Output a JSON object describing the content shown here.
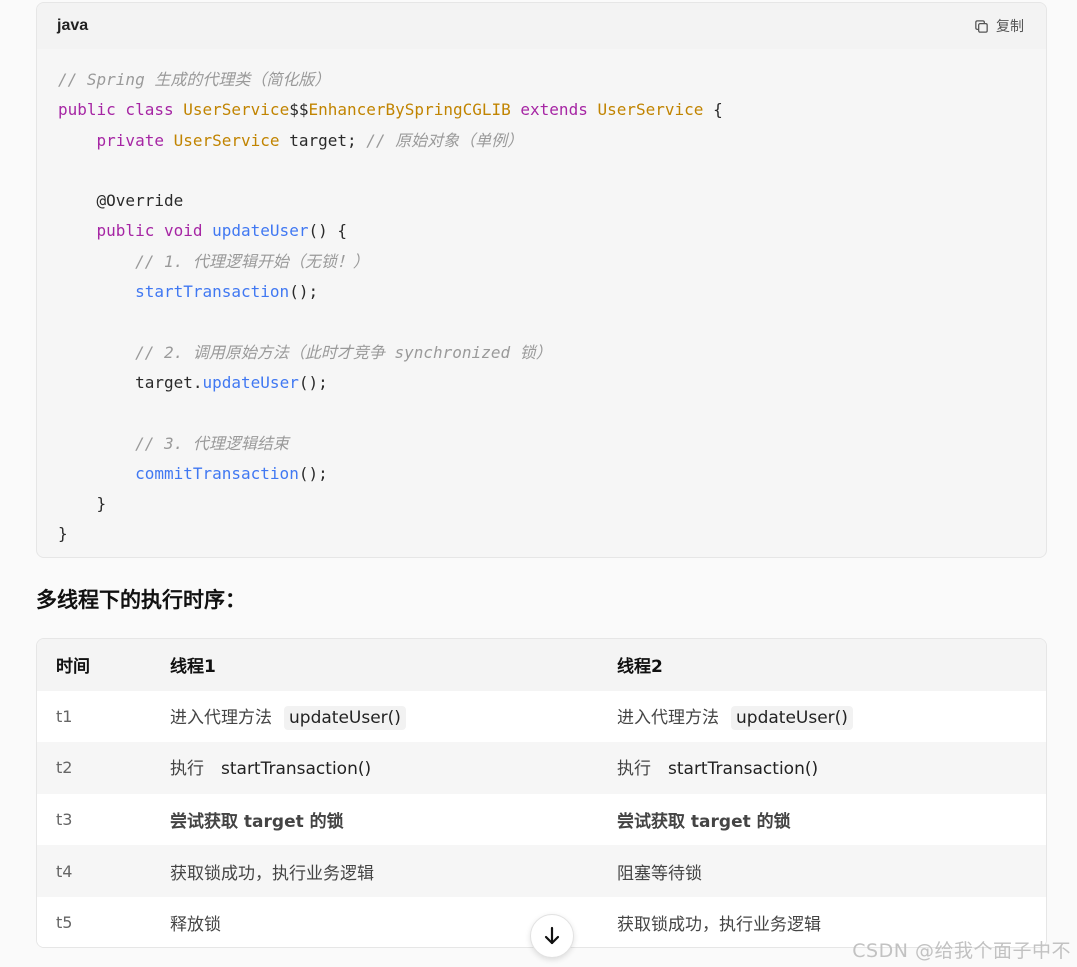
{
  "code_block": {
    "language": "java",
    "copy_label": "复制",
    "lines": [
      [
        {
          "t": "// Spring 生成的代理类（简化版）",
          "c": "comment"
        }
      ],
      [
        {
          "t": "public class ",
          "c": "kw"
        },
        {
          "t": "UserService",
          "c": "type"
        },
        {
          "t": "$$",
          "c": "plain"
        },
        {
          "t": "EnhancerBySpringCGLIB",
          "c": "type"
        },
        {
          "t": " extends ",
          "c": "kw"
        },
        {
          "t": "UserService",
          "c": "type"
        },
        {
          "t": " {",
          "c": "plain"
        }
      ],
      [
        {
          "t": "    ",
          "c": "plain"
        },
        {
          "t": "private ",
          "c": "kw"
        },
        {
          "t": "UserService",
          "c": "type"
        },
        {
          "t": " target; ",
          "c": "plain"
        },
        {
          "t": "// 原始对象（单例）",
          "c": "comment"
        }
      ],
      [],
      [
        {
          "t": "    @Override",
          "c": "plain"
        }
      ],
      [
        {
          "t": "    ",
          "c": "plain"
        },
        {
          "t": "public void ",
          "c": "kw"
        },
        {
          "t": "updateUser",
          "c": "fn"
        },
        {
          "t": "() {",
          "c": "plain"
        }
      ],
      [
        {
          "t": "        ",
          "c": "plain"
        },
        {
          "t": "// 1. 代理逻辑开始（无锁！）",
          "c": "comment"
        }
      ],
      [
        {
          "t": "        ",
          "c": "plain"
        },
        {
          "t": "startTransaction",
          "c": "fn"
        },
        {
          "t": "();",
          "c": "plain"
        }
      ],
      [],
      [
        {
          "t": "        ",
          "c": "plain"
        },
        {
          "t": "// 2. 调用原始方法（此时才竞争 synchronized 锁）",
          "c": "comment"
        }
      ],
      [
        {
          "t": "        target.",
          "c": "plain"
        },
        {
          "t": "updateUser",
          "c": "fn"
        },
        {
          "t": "();",
          "c": "plain"
        }
      ],
      [],
      [
        {
          "t": "        ",
          "c": "plain"
        },
        {
          "t": "// 3. 代理逻辑结束",
          "c": "comment"
        }
      ],
      [
        {
          "t": "        ",
          "c": "plain"
        },
        {
          "t": "commitTransaction",
          "c": "fn"
        },
        {
          "t": "();",
          "c": "plain"
        }
      ],
      [
        {
          "t": "    }",
          "c": "plain"
        }
      ],
      [
        {
          "t": "}",
          "c": "plain"
        }
      ]
    ]
  },
  "section_title": "多线程下的执行时序：",
  "table": {
    "headers": [
      "时间",
      "线程1",
      "线程2"
    ],
    "rows": [
      {
        "time": "t1",
        "thread1": {
          "text": "进入代理方法",
          "code": "updateUser()",
          "bold": false
        },
        "thread2": {
          "text": "进入代理方法",
          "code": "updateUser()",
          "bold": false
        }
      },
      {
        "time": "t2",
        "thread1": {
          "text": "执行",
          "code": "startTransaction()",
          "bold": false
        },
        "thread2": {
          "text": "执行",
          "code": "startTransaction()",
          "bold": false
        }
      },
      {
        "time": "t3",
        "thread1": {
          "text": "尝试获取 target 的锁",
          "code": "",
          "bold": true
        },
        "thread2": {
          "text": "尝试获取 target 的锁",
          "code": "",
          "bold": true
        }
      },
      {
        "time": "t4",
        "thread1": {
          "text": "获取锁成功，执行业务逻辑",
          "code": "",
          "bold": false
        },
        "thread2": {
          "text": "阻塞等待锁",
          "code": "",
          "bold": false
        }
      },
      {
        "time": "t5",
        "thread1": {
          "text": "释放锁",
          "code": "",
          "bold": false
        },
        "thread2": {
          "text": "获取锁成功，执行业务逻辑",
          "code": "",
          "bold": false
        }
      }
    ]
  },
  "scroll_button": {
    "icon": "arrow-down-icon"
  },
  "watermark": "CSDN @给我个面子中不"
}
